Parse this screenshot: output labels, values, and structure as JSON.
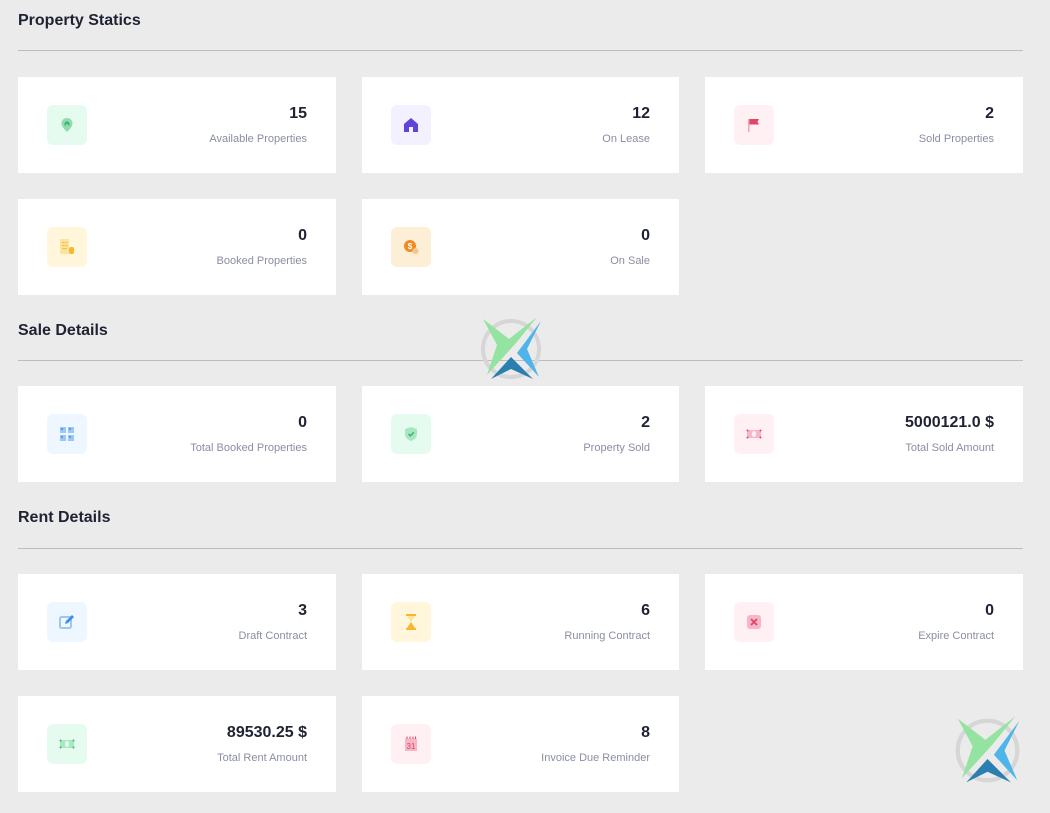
{
  "sections": {
    "property_statics": {
      "title": "Property Statics",
      "cards": [
        {
          "value": "15",
          "label": "Available Properties",
          "icon": "map-pin-home-icon",
          "color": "#5cc98a",
          "bg": "#e6fbef"
        },
        {
          "value": "12",
          "label": "On Lease",
          "icon": "house-icon",
          "color": "#6044d9",
          "bg": "#f3f1ff"
        },
        {
          "value": "2",
          "label": "Sold Properties",
          "icon": "flag-icon",
          "color": "#e0456a",
          "bg": "#fff0f3"
        },
        {
          "value": "0",
          "label": "Booked Properties",
          "icon": "document-coin-icon",
          "color": "#f5c34a",
          "bg": "#fff6db"
        },
        {
          "value": "0",
          "label": "On Sale",
          "icon": "price-tag-icon",
          "color": "#f08a24",
          "bg": "#fdefd6"
        }
      ]
    },
    "sale_details": {
      "title": "Sale Details",
      "cards": [
        {
          "value": "0",
          "label": "Total Booked Properties",
          "icon": "grid-icon",
          "color": "#4a90e2",
          "bg": "#eef6ff"
        },
        {
          "value": "2",
          "label": "Property Sold",
          "icon": "shield-check-icon",
          "color": "#5cc98a",
          "bg": "#e6fbef"
        },
        {
          "value": "5000121.0 $",
          "label": "Total Sold Amount",
          "icon": "banknote-icon",
          "color": "#e0456a",
          "bg": "#fff0f3"
        }
      ]
    },
    "rent_details": {
      "title": "Rent Details",
      "cards": [
        {
          "value": "3",
          "label": "Draft Contract",
          "icon": "edit-icon",
          "color": "#3b8ee8",
          "bg": "#eef6ff"
        },
        {
          "value": "6",
          "label": "Running Contract",
          "icon": "hourglass-icon",
          "color": "#f5b82e",
          "bg": "#fff6db"
        },
        {
          "value": "0",
          "label": "Expire Contract",
          "icon": "close-box-icon",
          "color": "#e0456a",
          "bg": "#fff0f3"
        },
        {
          "value": "89530.25 $",
          "label": "Total Rent Amount",
          "icon": "banknote-icon",
          "color": "#5cc98a",
          "bg": "#e6fbef"
        },
        {
          "value": "8",
          "label": "Invoice Due Reminder",
          "icon": "calendar-icon",
          "color": "#e0456a",
          "bg": "#fff0f3",
          "icon_text": "31"
        }
      ]
    }
  }
}
